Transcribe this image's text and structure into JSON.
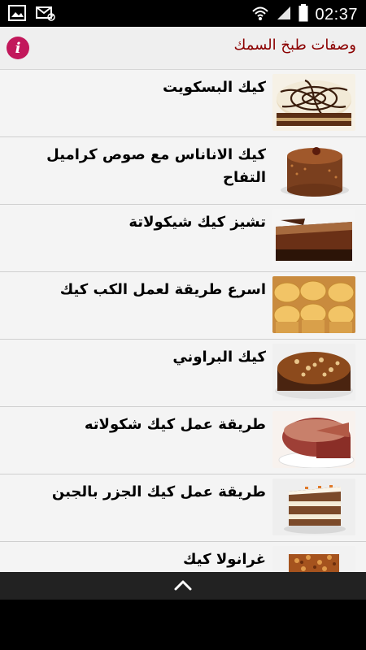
{
  "status_bar": {
    "time": "02:37",
    "icons": [
      "image-notification-icon",
      "mail-blocked-icon",
      "wifi-icon",
      "signal-icon",
      "battery-icon"
    ]
  },
  "header": {
    "title": "وصفات طبخ السمك",
    "info_icon": "info-icon"
  },
  "list": {
    "items": [
      {
        "label": "كيك البسكويت"
      },
      {
        "label": "كيك الاناناس مع صوص كراميل التفاح"
      },
      {
        "label": "تشيز كيك شيكولاتة"
      },
      {
        "label": "اسرع طريقة لعمل الكب كيك"
      },
      {
        "label": "كيك البراوني"
      },
      {
        "label": "طريقة عمل كيك شكولاته"
      },
      {
        "label": "طريقة عمل كيك الجزر بالجبن"
      },
      {
        "label": "غرانولا كيك"
      }
    ]
  },
  "bottom_bar": {
    "icon": "chevron-up-icon"
  },
  "colors": {
    "title": "#8b0000",
    "info": "#c2185b",
    "list_bg": "#f4f4f4"
  }
}
